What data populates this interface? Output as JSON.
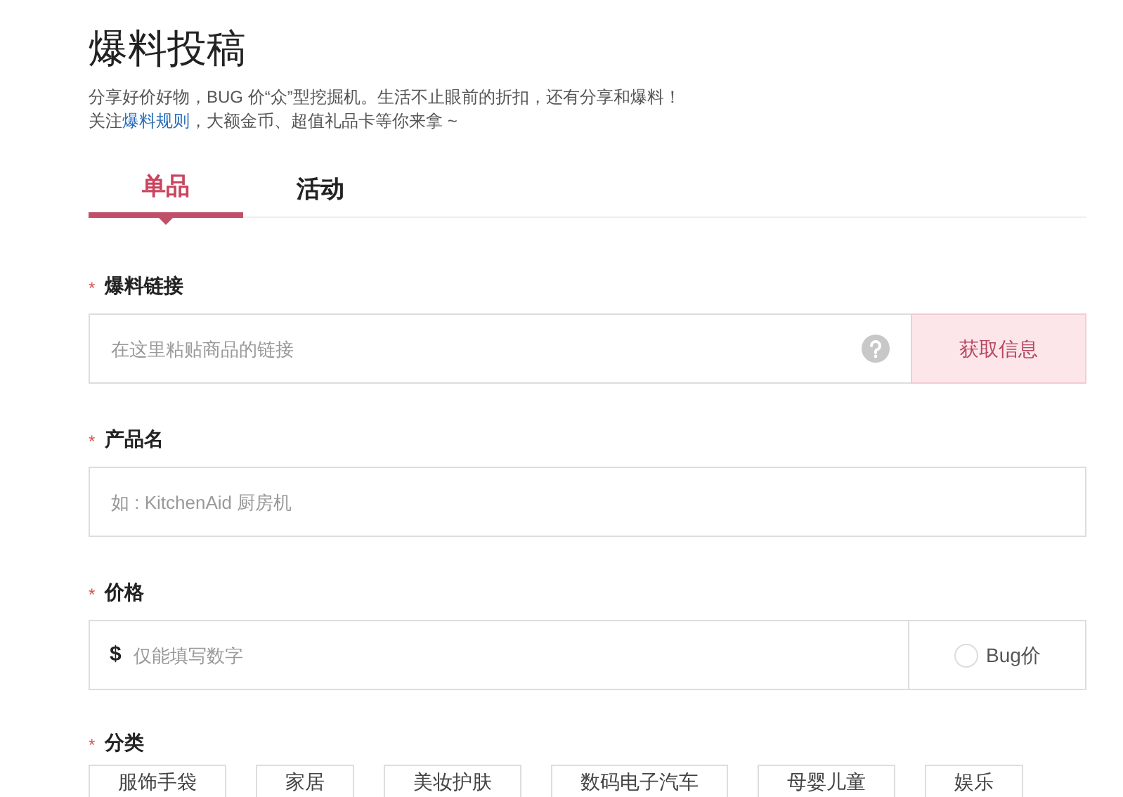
{
  "title": "爆料投稿",
  "intro": "分享好价好物，BUG 价“众”型挖掘机。生活不止眼前的折扣，还有分享和爆料！",
  "rules_line": {
    "before": "关注",
    "link": "爆料规则",
    "after": "，大额金币、超值礼品卡等你来拿 ~"
  },
  "tabs": [
    {
      "label": "单品",
      "selected": true
    },
    {
      "label": "活动",
      "selected": false
    }
  ],
  "link_field": {
    "required_mark": "*",
    "label": "爆料链接",
    "placeholder": "在这里粘贴商品的链接",
    "button": "获取信息"
  },
  "name_field": {
    "required_mark": "*",
    "label": "产品名",
    "placeholder": "如 : KitchenAid 厨房机"
  },
  "price_field": {
    "required_mark": "*",
    "label": "价格",
    "currency": "$",
    "placeholder": "仅能填写数字",
    "bug_price": {
      "label": "Bug价",
      "checked": false
    }
  },
  "category": {
    "required_mark": "*",
    "label": "分类",
    "options": [
      "服饰手袋",
      "家居",
      "美妆护肤",
      "数码电子汽车",
      "母婴儿童",
      "娱乐"
    ]
  }
}
